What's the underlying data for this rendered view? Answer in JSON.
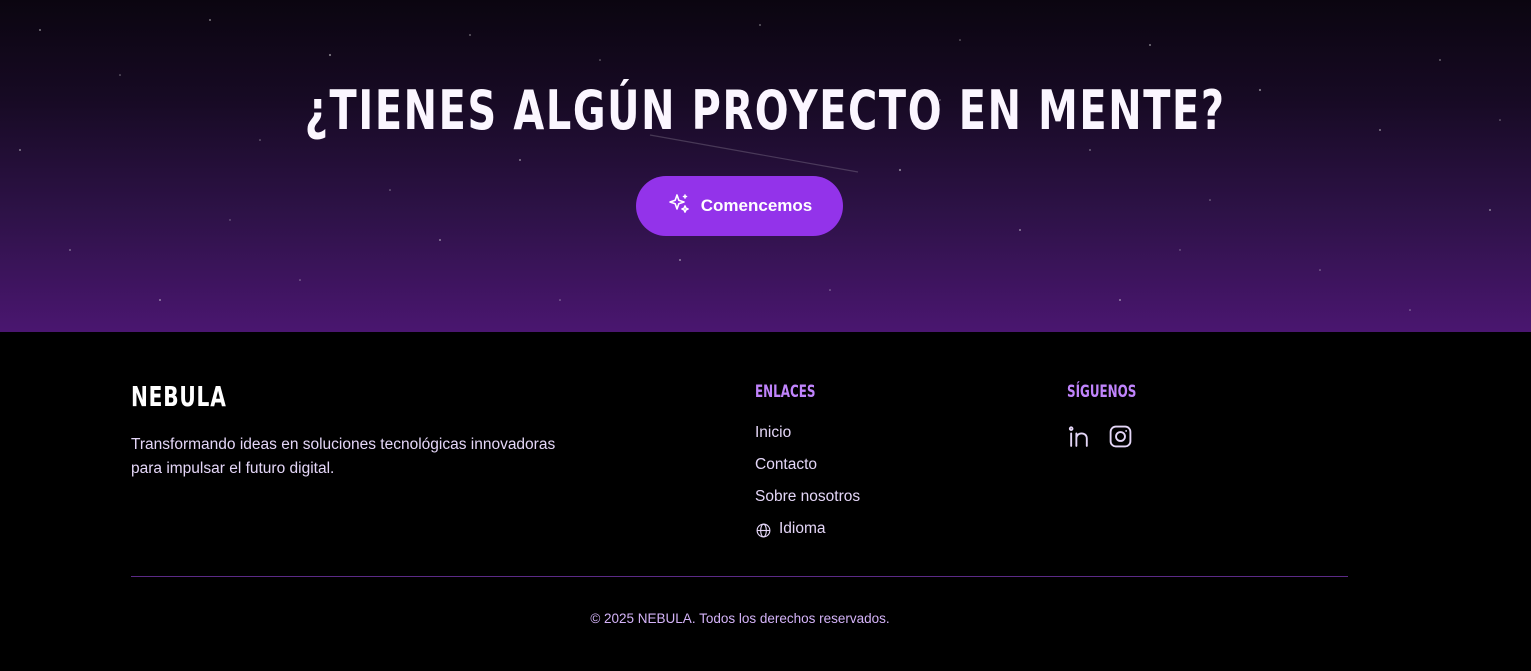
{
  "hero": {
    "title": "¿TIENES ALGÚN PROYECTO EN MENTE?",
    "cta_label": "Comencemos",
    "cta_icon": "sparkles-icon"
  },
  "footer": {
    "brand": "NEBULA",
    "tagline": "Transformando ideas en soluciones tecnológicas innovadoras para impulsar el futuro digital.",
    "links_heading": "ENLACES",
    "links": [
      {
        "label": "Inicio"
      },
      {
        "label": "Contacto"
      },
      {
        "label": "Sobre nosotros"
      },
      {
        "label": "Idioma",
        "icon": "globe-icon"
      }
    ],
    "social_heading": "SÍGUENOS",
    "social": [
      {
        "name": "linkedin-icon"
      },
      {
        "name": "instagram-icon"
      }
    ],
    "copyright": "© 2025 NEBULA. Todos los derechos reservados."
  },
  "colors": {
    "accent": "#9333ea",
    "heading_accent": "#c084fc",
    "text_muted": "#e4d6f7"
  }
}
